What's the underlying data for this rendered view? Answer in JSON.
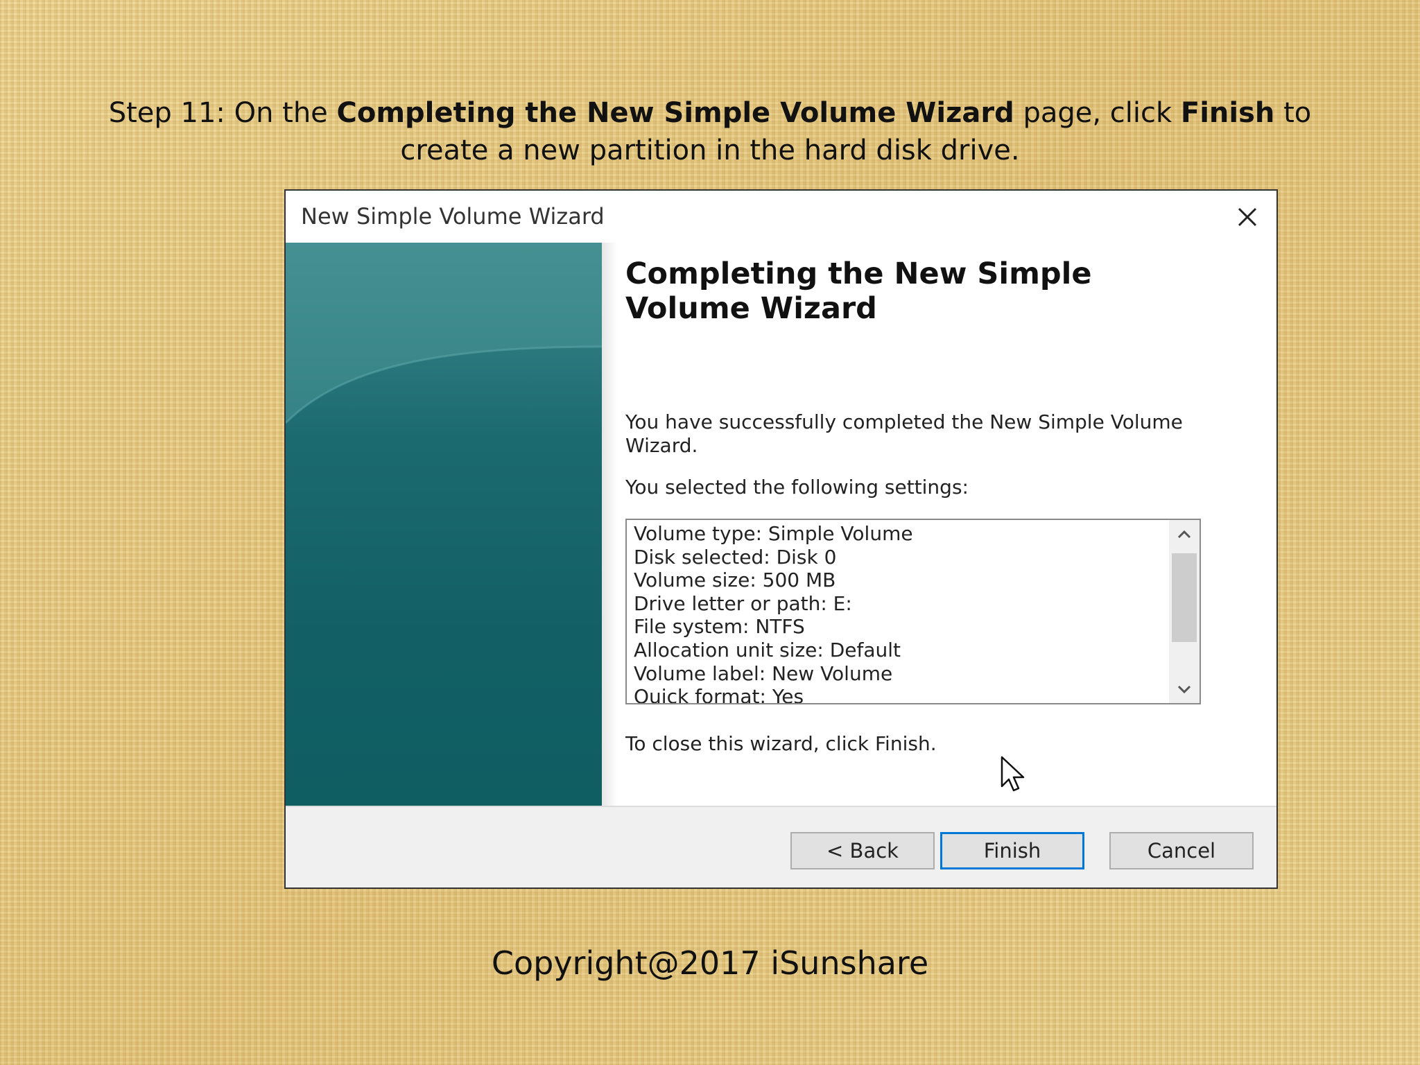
{
  "instruction": {
    "prefix": "Step 11: On the ",
    "bold_1": "Completing the New Simple Volume Wizard",
    "middle": " page, click ",
    "bold_2": "Finish",
    "suffix": " to create a new partition in the hard disk drive."
  },
  "dialog": {
    "title": "New Simple Volume Wizard",
    "heading": "Completing the New Simple Volume Wizard",
    "success_text": "You have successfully completed the New Simple Volume Wizard.",
    "settings_label": "You selected the following settings:",
    "settings": [
      "Volume type: Simple Volume",
      "Disk selected: Disk 0",
      "Volume size: 500 MB",
      "Drive letter or path: E:",
      "File system: NTFS",
      "Allocation unit size: Default",
      "Volume label: New Volume",
      "Quick format: Yes"
    ],
    "close_hint": "To close this wizard, click Finish.",
    "buttons": {
      "back": "< Back",
      "finish": "Finish",
      "cancel": "Cancel"
    },
    "accent_color": "#0078d7",
    "panel_color": "#126065"
  },
  "footer": "Copyright@2017  iSunshare"
}
